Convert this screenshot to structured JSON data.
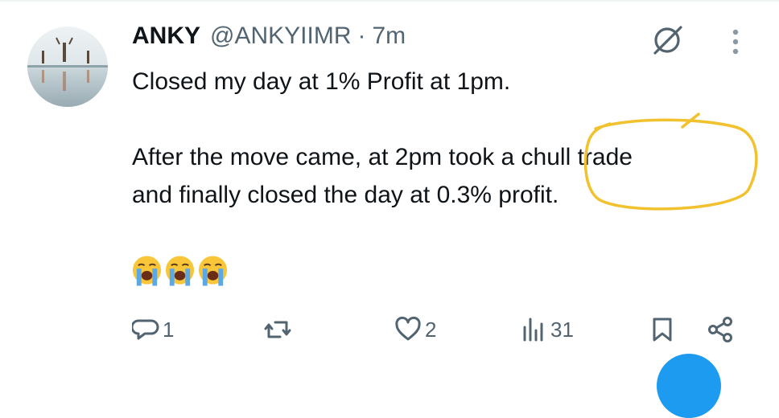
{
  "tweet": {
    "display_name": "ANKY",
    "handle": "@ANKYIIMR",
    "separator": "·",
    "time": "7m",
    "line1": "Closed my day at 1% Profit at 1pm.",
    "line2": "After the move came, at 2pm took a chull trade",
    "line3": "and finally closed the day at 0.3% profit.",
    "emojis": [
      "loudly-crying-face",
      "loudly-crying-face",
      "loudly-crying-face"
    ],
    "highlight_color": "#f2c12e"
  },
  "actions": {
    "replies": "1",
    "reposts": "",
    "likes": "2",
    "views": "31"
  },
  "icons": [
    "grok-icon",
    "more-icon",
    "reply-icon",
    "repost-icon",
    "like-icon",
    "views-icon",
    "bookmark-icon",
    "share-icon"
  ],
  "colors": {
    "text": "#0f1419",
    "muted": "#536471",
    "accent": "#1d9bf0"
  }
}
